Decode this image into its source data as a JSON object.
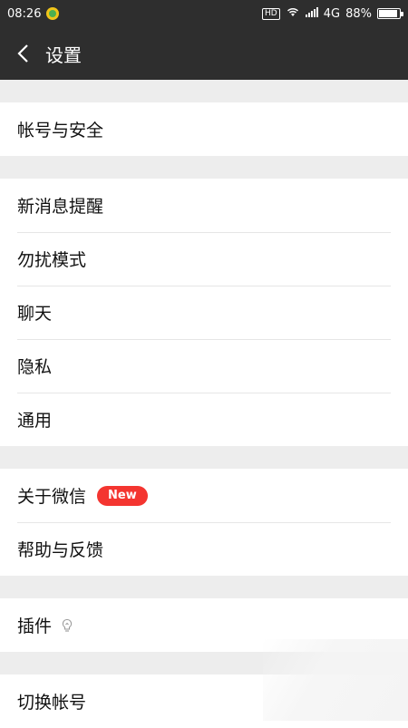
{
  "status": {
    "time": "08:26",
    "hd": "HD",
    "network": "4G",
    "battery": "88%",
    "battery_level": 0.88
  },
  "nav": {
    "title": "设置"
  },
  "groups": {
    "account": {
      "security": "帐号与安全"
    },
    "prefs": {
      "notifications": "新消息提醒",
      "dnd": "勿扰模式",
      "chat": "聊天",
      "privacy": "隐私",
      "general": "通用"
    },
    "about": {
      "about": "关于微信",
      "new_badge": "New",
      "help": "帮助与反馈"
    },
    "plugins": {
      "plugins": "插件"
    },
    "switch": {
      "switch_account": "切换帐号"
    }
  },
  "colors": {
    "header_bg": "#2e2e2e",
    "page_bg": "#ededed",
    "badge_red": "#f43530"
  }
}
